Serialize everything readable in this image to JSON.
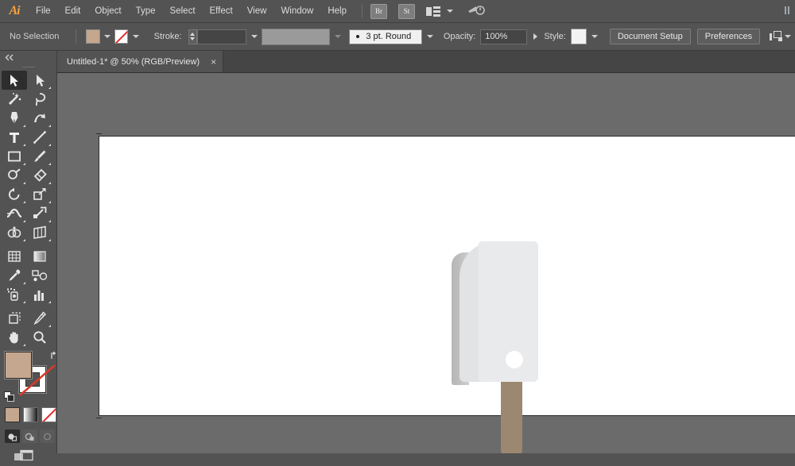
{
  "app": {
    "name": "Adobe Illustrator",
    "logo_text": "Ai"
  },
  "menubar": {
    "items": [
      {
        "label": "File"
      },
      {
        "label": "Edit"
      },
      {
        "label": "Object"
      },
      {
        "label": "Type"
      },
      {
        "label": "Select"
      },
      {
        "label": "Effect"
      },
      {
        "label": "View"
      },
      {
        "label": "Window"
      },
      {
        "label": "Help"
      }
    ],
    "bridge_badge": "Br",
    "stock_badge": "St",
    "workspace_icon": "workspace-switcher-icon",
    "help_search_icon": "help-search-icon"
  },
  "controlbar": {
    "selection_status": "No Selection",
    "fill_label": "Fill",
    "fill_color": "#c4a78e",
    "stroke_swatch_label": "Stroke color: None",
    "stroke_label": "Stroke:",
    "stroke_weight_value": "",
    "stroke_profile_value": "",
    "brush_definition": "3 pt. Round",
    "opacity_label": "Opacity:",
    "opacity_value": "100%",
    "style_label": "Style:",
    "document_setup_label": "Document Setup",
    "preferences_label": "Preferences",
    "align_icon": "align-arrange-icon"
  },
  "tabbar": {
    "document_title": "Untitled-1* @ 50% (RGB/Preview)",
    "close_glyph": "×"
  },
  "toolbar": {
    "collapse_glyph": "«",
    "tools": [
      {
        "name": "selection-tool",
        "label": "Selection Tool",
        "active": true
      },
      {
        "name": "direct-selection-tool",
        "label": "Direct Selection Tool",
        "active": false
      },
      {
        "name": "magic-wand-tool",
        "label": "Magic Wand Tool",
        "active": false
      },
      {
        "name": "lasso-tool",
        "label": "Lasso Tool",
        "active": false
      },
      {
        "name": "pen-tool",
        "label": "Pen Tool",
        "active": false
      },
      {
        "name": "curvature-tool",
        "label": "Curvature Tool",
        "active": false
      },
      {
        "name": "type-tool",
        "label": "Type Tool",
        "active": false
      },
      {
        "name": "line-segment-tool",
        "label": "Line Segment Tool",
        "active": false
      },
      {
        "name": "rectangle-tool",
        "label": "Rectangle Tool",
        "active": false
      },
      {
        "name": "paintbrush-tool",
        "label": "Paintbrush Tool",
        "active": false
      },
      {
        "name": "shaper-tool",
        "label": "Shaper Tool",
        "active": false
      },
      {
        "name": "eraser-tool",
        "label": "Eraser Tool",
        "active": false
      },
      {
        "name": "rotate-tool",
        "label": "Rotate Tool",
        "active": false
      },
      {
        "name": "scale-tool",
        "label": "Scale Tool",
        "active": false
      },
      {
        "name": "width-tool",
        "label": "Width Tool",
        "active": false
      },
      {
        "name": "free-transform-tool",
        "label": "Free Transform Tool",
        "active": false
      },
      {
        "name": "shape-builder-tool",
        "label": "Shape Builder Tool",
        "active": false
      },
      {
        "name": "perspective-grid-tool",
        "label": "Perspective Grid Tool",
        "active": false
      },
      {
        "name": "mesh-tool",
        "label": "Mesh Tool",
        "active": false
      },
      {
        "name": "gradient-tool",
        "label": "Gradient Tool",
        "active": false
      },
      {
        "name": "eyedropper-tool",
        "label": "Eyedropper Tool",
        "active": false
      },
      {
        "name": "blend-tool",
        "label": "Blend Tool",
        "active": false
      },
      {
        "name": "symbol-sprayer-tool",
        "label": "Symbol Sprayer Tool",
        "active": false
      },
      {
        "name": "column-graph-tool",
        "label": "Column Graph Tool",
        "active": false
      },
      {
        "name": "artboard-tool",
        "label": "Artboard Tool",
        "active": false
      },
      {
        "name": "slice-tool",
        "label": "Slice Tool",
        "active": false
      },
      {
        "name": "hand-tool",
        "label": "Hand Tool",
        "active": false
      },
      {
        "name": "zoom-tool",
        "label": "Zoom Tool",
        "active": false
      }
    ],
    "fill_color": "#c4a78e",
    "stroke_color": "none",
    "color_modes": [
      {
        "name": "color-mode-button",
        "label": "Color"
      },
      {
        "name": "gradient-mode-button",
        "label": "Gradient"
      },
      {
        "name": "none-mode-button",
        "label": "None"
      }
    ],
    "draw_modes": [
      {
        "name": "draw-normal-button",
        "label": "Draw Normal",
        "active": true
      },
      {
        "name": "draw-behind-button",
        "label": "Draw Behind",
        "active": false
      },
      {
        "name": "draw-inside-button",
        "label": "Draw Inside",
        "active": false
      }
    ],
    "screen_mode_label": "Change Screen Mode"
  },
  "canvas": {
    "background_color": "#6b6b6b",
    "artboard_color": "#ffffff",
    "zoom_level": "50%",
    "color_mode": "RGB",
    "view_mode": "Preview",
    "artwork": {
      "name": "popsicle-illustration",
      "body_color": "#e9eaeb",
      "body_shade_color": "#e2e3e4",
      "side_shadow_color": "#bdbdbd",
      "highlight_color": "#ffffff",
      "stick_color": "#9c8770"
    }
  }
}
